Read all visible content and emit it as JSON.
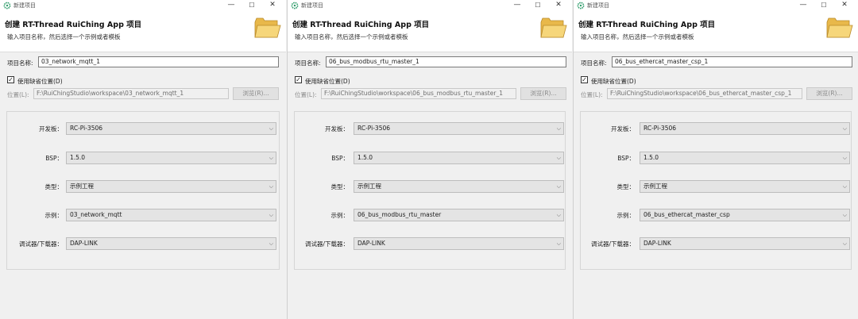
{
  "dialogs": [
    {
      "window_title": "新建项目",
      "header": {
        "title": "创建 RT-Thread RuiChing App 项目",
        "description": "输入项目名称，然后选择一个示例或者模板"
      },
      "project_name_label": "项目名称:",
      "project_name_value": "03_network_mqtt_1",
      "use_default_location_label": "使用缺省位置(D)",
      "use_default_location_checked": "✓",
      "location_label": "位置(L):",
      "location_value": "F:\\RuiChingStudio\\workspace\\03_network_mqtt_1",
      "browse_label": "浏览(R)...",
      "fields": [
        {
          "label": "开发板：",
          "value": "RC-Pi-3506"
        },
        {
          "label": "BSP：",
          "value": "1.5.0"
        },
        {
          "label": "类型：",
          "value": "示例工程"
        },
        {
          "label": "示例：",
          "value": "03_network_mqtt"
        },
        {
          "label": "调试器/下载器：",
          "value": "DAP-LINK"
        }
      ]
    },
    {
      "window_title": "新建项目",
      "header": {
        "title": "创建 RT-Thread RuiChing App 项目",
        "description": "输入项目名称，然后选择一个示例或者模板"
      },
      "project_name_label": "项目名称:",
      "project_name_value": "06_bus_modbus_rtu_master_1",
      "use_default_location_label": "使用缺省位置(D)",
      "use_default_location_checked": "✓",
      "location_label": "位置(L):",
      "location_value": "F:\\RuiChingStudio\\workspace\\06_bus_modbus_rtu_master_1",
      "browse_label": "浏览(R)...",
      "fields": [
        {
          "label": "开发板：",
          "value": "RC-Pi-3506"
        },
        {
          "label": "BSP：",
          "value": "1.5.0"
        },
        {
          "label": "类型：",
          "value": "示例工程"
        },
        {
          "label": "示例：",
          "value": "06_bus_modbus_rtu_master"
        },
        {
          "label": "调试器/下载器：",
          "value": "DAP-LINK"
        }
      ]
    },
    {
      "window_title": "新建项目",
      "header": {
        "title": "创建 RT-Thread RuiChing App 项目",
        "description": "输入项目名称，然后选择一个示例或者模板"
      },
      "project_name_label": "项目名称:",
      "project_name_value": "06_bus_ethercat_master_csp_1",
      "use_default_location_label": "使用缺省位置(D)",
      "use_default_location_checked": "✓",
      "location_label": "位置(L):",
      "location_value": "F:\\RuiChingStudio\\workspace\\06_bus_ethercat_master_csp_1",
      "browse_label": "浏览(R)...",
      "fields": [
        {
          "label": "开发板：",
          "value": "RC-Pi-3506"
        },
        {
          "label": "BSP：",
          "value": "1.5.0"
        },
        {
          "label": "类型：",
          "value": "示例工程"
        },
        {
          "label": "示例：",
          "value": "06_bus_ethercat_master_csp"
        },
        {
          "label": "调试器/下载器：",
          "value": "DAP-LINK"
        }
      ]
    }
  ],
  "window_controls": {
    "minimize": "—",
    "maximize": "☐",
    "close": "✕"
  },
  "icons": {
    "app": "gear-icon",
    "header": "folder-icon",
    "combo": "chevron-down-icon"
  },
  "colors": {
    "accent": "#2e9c6a",
    "folder": "#e8b84a"
  }
}
